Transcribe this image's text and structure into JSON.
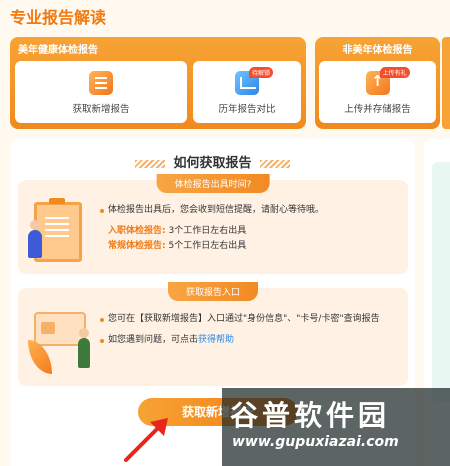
{
  "page": {
    "title": "专业报告解读"
  },
  "groups": {
    "healthy": {
      "title": "美年健康体检报告",
      "cards": [
        {
          "label": "获取新增报告",
          "icon": "document-icon"
        },
        {
          "label": "历年报告对比",
          "icon": "chart-icon",
          "tag": "待解锁"
        }
      ]
    },
    "other": {
      "title": "非美年体检报告",
      "cards": [
        {
          "label": "上传并存储报告",
          "icon": "upload-icon",
          "tag": "上传有礼"
        }
      ]
    }
  },
  "howto": {
    "title": "如何获取报告",
    "section1": {
      "label": "体检报告出具时间?",
      "note": "体检报告出具后，您会收到短信提醒，请耐心等待哦。",
      "rows": [
        {
          "key": "入职体检报告:",
          "value": "3个工作日左右出具"
        },
        {
          "key": "常规体检报告:",
          "value": "5个工作日左右出具"
        }
      ]
    },
    "section2": {
      "label": "获取报告入口",
      "line1": "您可在【获取新增报告】入口通过\"身份信息\"、\"卡号/卡密\"查询报告",
      "line2_prefix": "如您遇到问题，可点击",
      "line2_link": "获得帮助"
    },
    "cta": "获取新增报告"
  },
  "watermark": {
    "title": "谷普软件园",
    "url": "www.gupuxiazai.com"
  },
  "colors": {
    "accent": "#f07a10",
    "link": "#2b87e8",
    "tag": "#f44d2e"
  }
}
